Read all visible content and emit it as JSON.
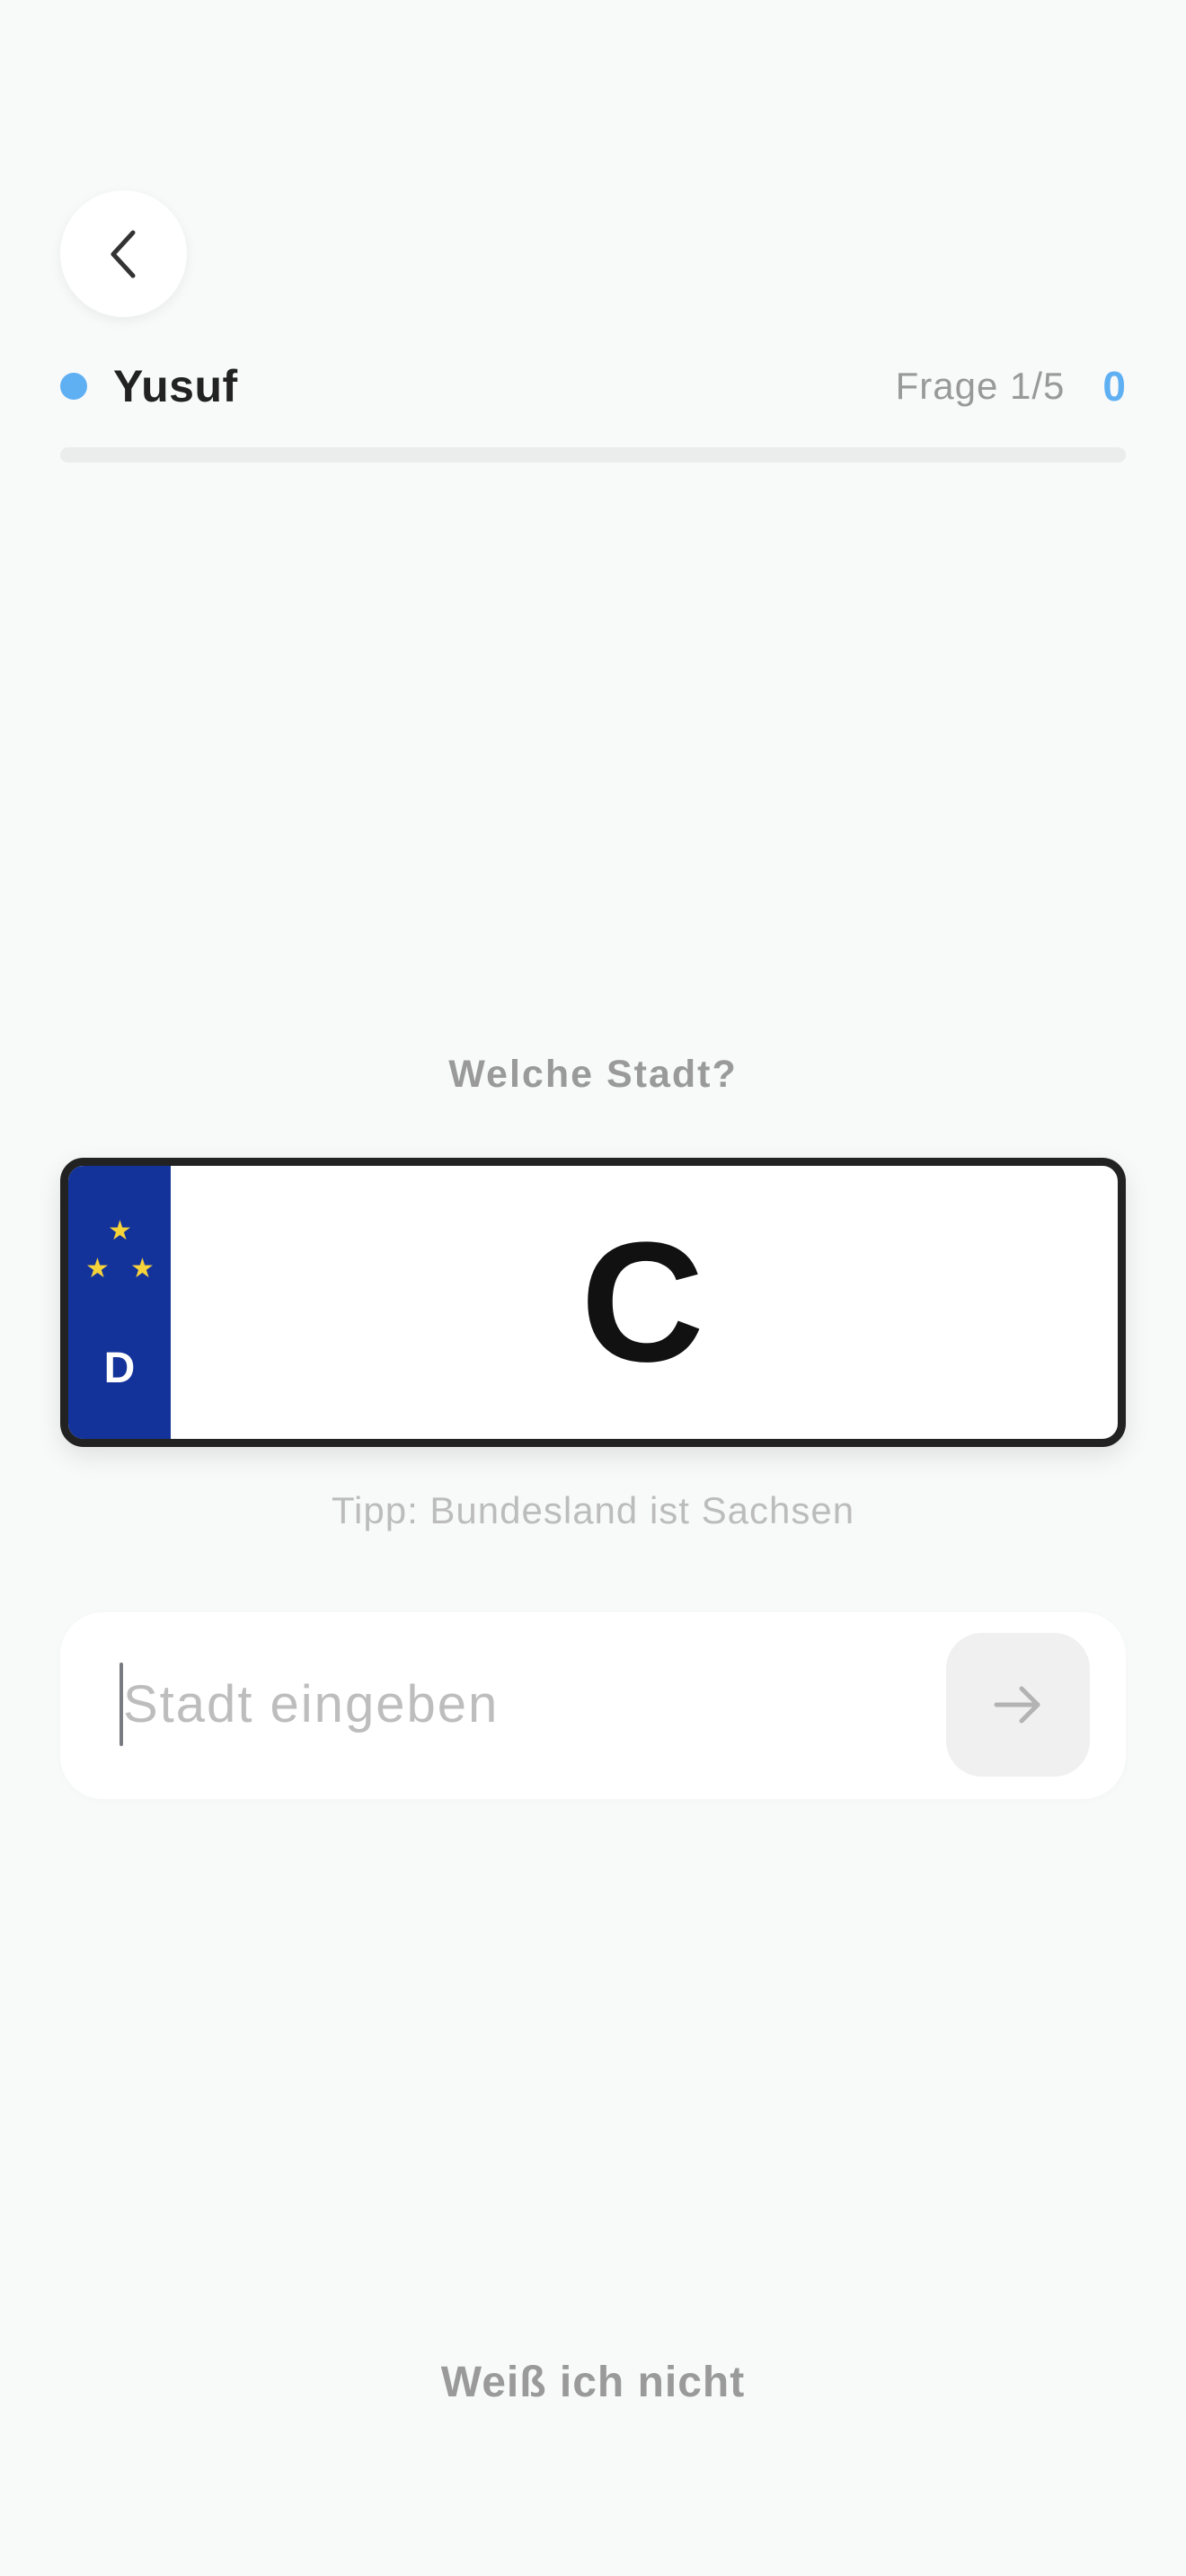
{
  "header": {
    "back_icon": "chevron-left-icon"
  },
  "player": {
    "name": "Yusuf",
    "dot_color": "#5fb0f3",
    "question_counter": "Frage 1/5",
    "score": "0",
    "progress_fraction": 0
  },
  "quiz": {
    "prompt": "Welche Stadt?",
    "plate": {
      "country_code": "D",
      "letters": "C",
      "eu_band_color": "#14339a",
      "star_color": "#f7d33a"
    },
    "hint": "Tipp: Bundesland ist Sachsen"
  },
  "answer": {
    "placeholder": "Stadt eingeben",
    "value": "",
    "submit_icon": "arrow-right-icon"
  },
  "footer": {
    "skip_label": "Weiß ich nicht"
  },
  "colors": {
    "accent": "#5fb0f3",
    "background": "#f8f9f9"
  }
}
